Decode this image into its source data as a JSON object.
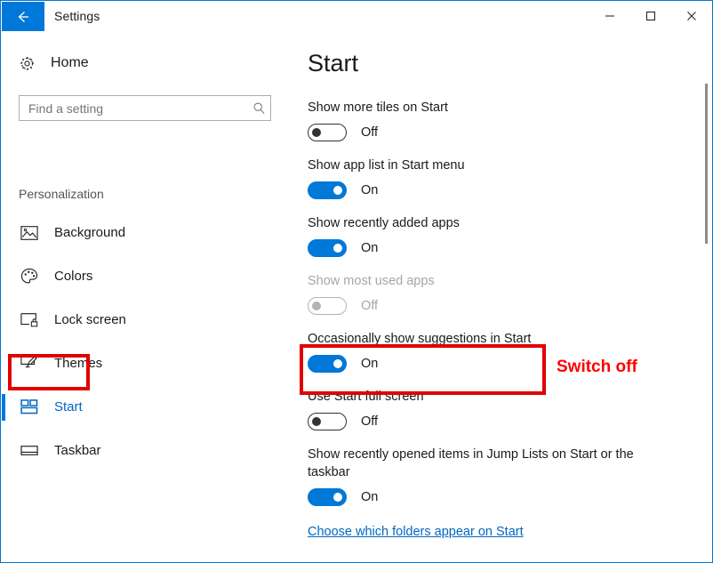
{
  "window": {
    "title": "Settings",
    "back_icon": "back-arrow-icon",
    "controls": {
      "minimize": "minimize-icon",
      "maximize": "maximize-icon",
      "close": "close-icon"
    },
    "accent_color": "#0078d7"
  },
  "sidebar": {
    "home": {
      "label": "Home",
      "icon": "gear-icon"
    },
    "search": {
      "placeholder": "Find a setting",
      "value": "",
      "icon": "search-icon"
    },
    "section_title": "Personalization",
    "items": [
      {
        "label": "Background",
        "icon": "picture-icon",
        "selected": false
      },
      {
        "label": "Colors",
        "icon": "palette-icon",
        "selected": false
      },
      {
        "label": "Lock screen",
        "icon": "lock-screen-icon",
        "selected": false
      },
      {
        "label": "Themes",
        "icon": "themes-icon",
        "selected": false
      },
      {
        "label": "Start",
        "icon": "start-tiles-icon",
        "selected": true
      },
      {
        "label": "Taskbar",
        "icon": "taskbar-icon",
        "selected": false
      }
    ]
  },
  "main": {
    "title": "Start",
    "settings": [
      {
        "label": "Show more tiles on Start",
        "state": "Off",
        "on": false,
        "disabled": false
      },
      {
        "label": "Show app list in Start menu",
        "state": "On",
        "on": true,
        "disabled": false
      },
      {
        "label": "Show recently added apps",
        "state": "On",
        "on": true,
        "disabled": false
      },
      {
        "label": "Show most used apps",
        "state": "Off",
        "on": false,
        "disabled": true
      },
      {
        "label": "Occasionally show suggestions in Start",
        "state": "On",
        "on": true,
        "disabled": false
      },
      {
        "label": "Use Start full screen",
        "state": "Off",
        "on": false,
        "disabled": false
      },
      {
        "label": "Show recently opened items in Jump Lists on Start or the taskbar",
        "state": "On",
        "on": true,
        "disabled": false
      }
    ],
    "folders_link": "Choose which folders appear on Start"
  },
  "annotations": {
    "note_text": "Switch off",
    "note_color": "#ff0000",
    "box_color": "#e00000"
  },
  "scrollbar": {
    "thumb_label": "scrollbar-thumb"
  }
}
